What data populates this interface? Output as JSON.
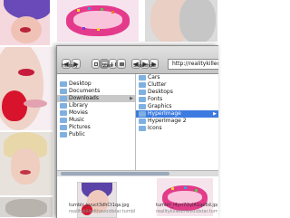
{
  "finder": {
    "toolbar": {
      "back_label": "◀",
      "forward_label": "▶",
      "view_label": "View",
      "history_label": "History",
      "slideshow_label": "Slideshow",
      "url_value": "http://realitykilledth"
    },
    "columns": [
      {
        "items": [
          "Desktop",
          "Documents",
          "Downloads",
          "Library",
          "Movies",
          "Music",
          "Pictures",
          "Public"
        ],
        "selected": "Downloads"
      },
      {
        "items": [
          "Cars",
          "Clutter",
          "Desktops",
          "Fonts",
          "Graphics",
          "HyperImage",
          "HyperImage 2",
          "Icons"
        ],
        "selected": "HyperImage"
      }
    ],
    "previews": [
      {
        "name": "tumblr_kvuct3dhCt1qa.jpg",
        "source": "realitykilledthevoidstar.tumbl"
      },
      {
        "name": "tumblr_l4yri7OylA1qe6d.jpg",
        "source": "realitykilledthevoidstar.tumbl"
      }
    ]
  },
  "colors": {
    "selection_active": "#3d7be0",
    "selection_inactive": "#c9c9c9",
    "folder_icon": "#7fb1e0"
  }
}
